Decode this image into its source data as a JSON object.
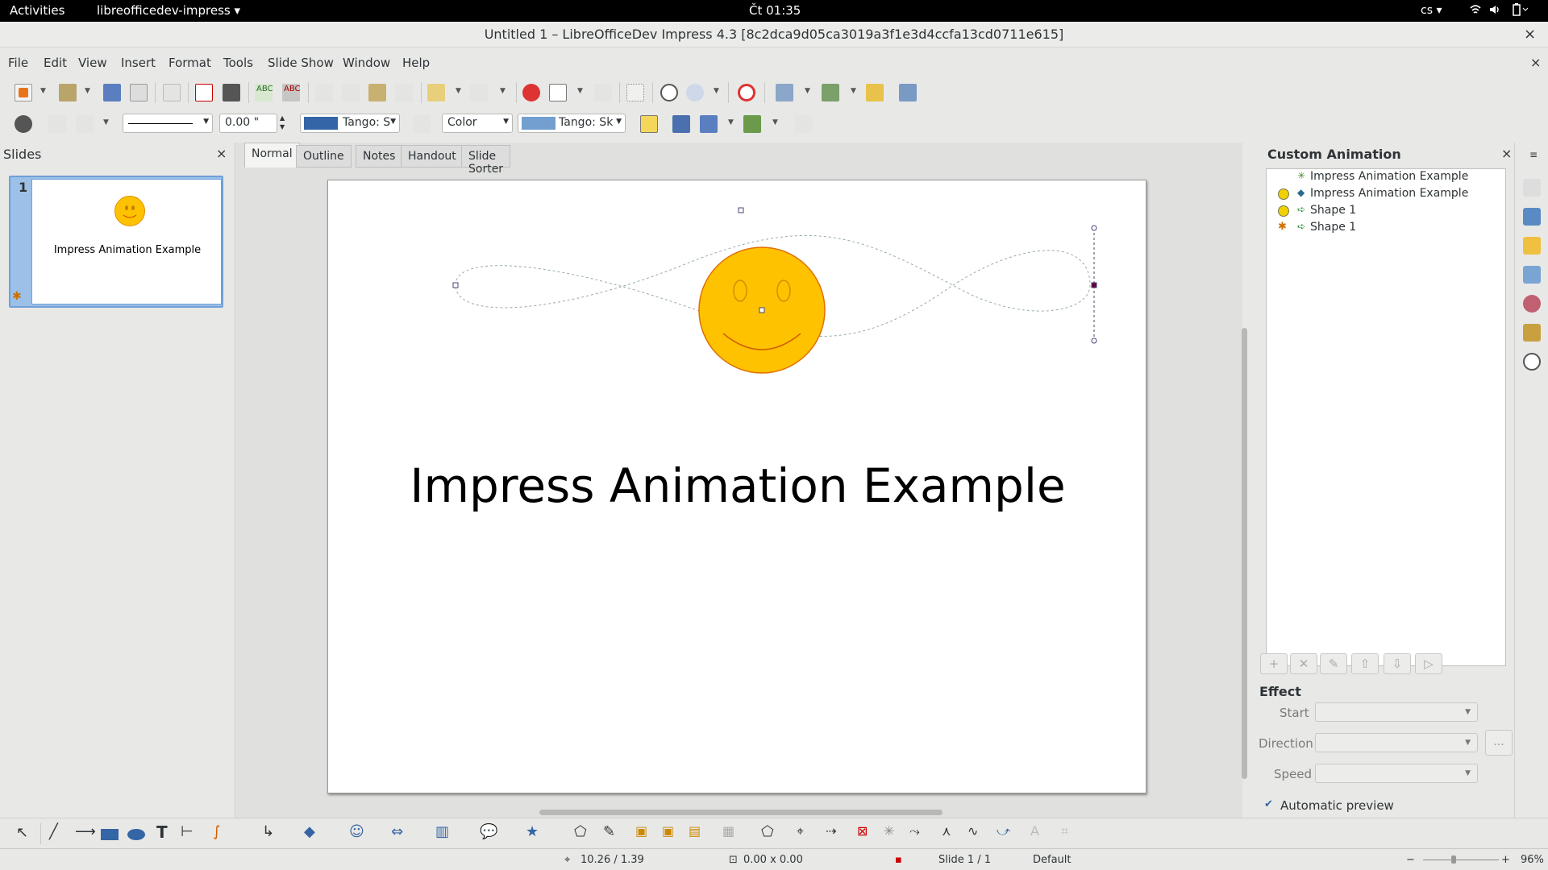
{
  "topbar": {
    "activities": "Activities",
    "app_name": "libreofficedev-impress ▾",
    "clock": "Čt 01:35",
    "lang": "cs ▾",
    "sys_icons": "wifi-icon volume-icon battery-icon"
  },
  "window": {
    "title": "Untitled 1 – LibreOfficeDev Impress 4.3 [8c2dca9d05ca3019a3f1e3d4ccfa13cd0711e615]",
    "close": "×"
  },
  "menu": [
    "File",
    "Edit",
    "View",
    "Insert",
    "Format",
    "Tools",
    "Slide Show",
    "Window",
    "Help"
  ],
  "menu_close": "×",
  "linebar": {
    "width_value": "0.00 \"",
    "line_color": "Tango: S",
    "area_style": "Color",
    "area_color": "Tango: Sk"
  },
  "slides_panel": {
    "title": "Slides",
    "close": "×",
    "slide_number": "1",
    "thumb_title": "Impress Animation Example"
  },
  "view_tabs": [
    "Normal",
    "Outline",
    "Notes",
    "Handout",
    "Slide Sorter"
  ],
  "slide": {
    "title": "Impress Animation Example"
  },
  "custom_animation": {
    "title": "Custom Animation",
    "close": "×",
    "items": [
      {
        "label": "Impress Animation Example",
        "icon": "effect-sparkle-icon"
      },
      {
        "label": "Impress Animation Example",
        "icon": "trigger-clock-icon"
      },
      {
        "label": "Shape 1",
        "icon": "trigger-clock-icon"
      },
      {
        "label": "Shape 1",
        "icon": "motion-path-icon"
      }
    ],
    "buttons": [
      "+",
      "✕",
      "✎",
      "⇧",
      "⇩",
      "▷"
    ],
    "effect_heading": "Effect",
    "start_label": "Start",
    "direction_label": "Direction",
    "speed_label": "Speed",
    "more_button": "...",
    "auto_preview_label": "Automatic preview",
    "auto_preview_checked": true
  },
  "status": {
    "position": "10.26 / 1.39",
    "size": "0.00 x 0.00",
    "slide": "Slide 1 / 1",
    "master": "Default",
    "zoom": "96%"
  }
}
